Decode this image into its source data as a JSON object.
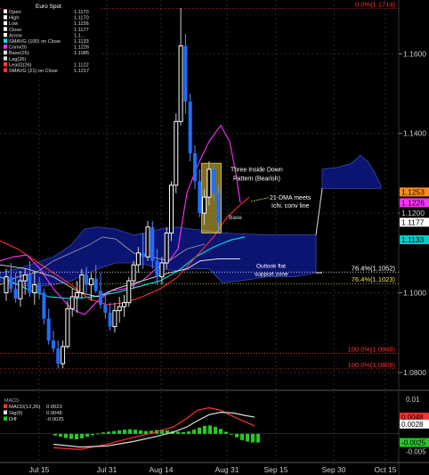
{
  "chart_data": {
    "type": "candlestick",
    "main_legend": {
      "title": "Euro Spot",
      "items": [
        {
          "name": "Open",
          "value": "1.1170",
          "color": "#ffffff"
        },
        {
          "name": "High",
          "value": "1.1170",
          "color": "#ffffff"
        },
        {
          "name": "Low",
          "value": "1.1156",
          "color": "#ffffff"
        },
        {
          "name": "Close",
          "value": "1.1177",
          "color": "#ffffff"
        },
        {
          "name": "Arrow",
          "value": "1.1...",
          "color": "#ffffff"
        },
        {
          "name": "SMAVG (100) on Close",
          "value": "1.1133",
          "color": "#00e5e5"
        },
        {
          "name": "Conv(9)",
          "value": "1.1226",
          "color": "#ff33ff"
        },
        {
          "name": "Base(26)",
          "value": "1.1085",
          "color": "#dddddd"
        },
        {
          "name": "Lag(26)",
          "value": "",
          "color": "#dddddd"
        },
        {
          "name": "Lead2(26)",
          "value": "1.1122",
          "color": "#ff4444"
        },
        {
          "name": "SMAVG (21) on Close",
          "value": "1.1217",
          "color": "#ff3030"
        }
      ]
    },
    "x_ticks": [
      "Jul 15",
      "Jul 31",
      "Aug 14",
      "Aug 31",
      "Sep 15",
      "Sep 30",
      "Oct 15"
    ],
    "y_ticks": [
      1.08,
      1.1,
      1.12,
      1.14,
      1.16
    ],
    "y_tick_labels": [
      "1.0800",
      "1.1000",
      "1.1200",
      "1.1400",
      "1.1600"
    ],
    "ylim": [
      1.0755,
      1.1735
    ],
    "fib_levels": [
      {
        "label": "0.0%(1.1714)",
        "value": 1.1714,
        "color": "#ff3030"
      },
      {
        "label": "76.4%(1.1052)",
        "value": 1.1052,
        "color": "#ffffff"
      },
      {
        "label": "76.4%(1.1023)",
        "value": 1.1023,
        "color": "#e8e840"
      },
      {
        "label": "100.0%(1.0848)",
        "value": 1.0848,
        "color": "#ff3030"
      },
      {
        "label": "100.0%(1.0809)",
        "value": 1.0809,
        "color": "#ff3030"
      }
    ],
    "annotations": {
      "pattern": [
        "Three Inside Down",
        "Pattern (Bearish)"
      ],
      "dma": [
        "21-DMA meets",
        "Ichi. conv line"
      ],
      "base": "Base",
      "cloud": [
        "Outlook flat",
        "support zone"
      ]
    },
    "price_tags": [
      {
        "value": 1.1253,
        "label": "1.1253",
        "bg": "#ff8c1a",
        "fg": "#000000"
      },
      {
        "value": 1.1226,
        "label": "1.1226",
        "bg": "#ff33ff",
        "fg": "#000000"
      },
      {
        "value": 1.12,
        "label": "1.1200",
        "bg": "#000000",
        "fg": "#cccccc"
      },
      {
        "value": 1.1177,
        "label": "1.1177",
        "bg": "#ffffff",
        "fg": "#000000"
      },
      {
        "value": 1.1133,
        "label": "1.1133",
        "bg": "#00cccc",
        "fg": "#000000"
      }
    ],
    "candles": [
      {
        "o": 1.1,
        "h": 1.106,
        "l": 1.098,
        "c": 1.104
      },
      {
        "o": 1.104,
        "h": 1.1075,
        "l": 1.1,
        "c": 1.101
      },
      {
        "o": 1.101,
        "h": 1.105,
        "l": 1.0975,
        "c": 1.0985
      },
      {
        "o": 1.0985,
        "h": 1.1055,
        "l": 1.0965,
        "c": 1.103
      },
      {
        "o": 1.103,
        "h": 1.106,
        "l": 1.0995,
        "c": 1.1045
      },
      {
        "o": 1.1045,
        "h": 1.108,
        "l": 1.099,
        "c": 1.1
      },
      {
        "o": 1.1,
        "h": 1.1055,
        "l": 1.097,
        "c": 1.102
      },
      {
        "o": 1.102,
        "h": 1.104,
        "l": 1.0985,
        "c": 1.1
      },
      {
        "o": 1.1,
        "h": 1.101,
        "l": 1.092,
        "c": 1.0935
      },
      {
        "o": 1.0935,
        "h": 1.096,
        "l": 1.087,
        "c": 1.088
      },
      {
        "o": 1.088,
        "h": 1.0905,
        "l": 1.085,
        "c": 1.086
      },
      {
        "o": 1.086,
        "h": 1.088,
        "l": 1.081,
        "c": 1.0822
      },
      {
        "o": 1.0822,
        "h": 1.088,
        "l": 1.081,
        "c": 1.0865
      },
      {
        "o": 1.0865,
        "h": 1.098,
        "l": 1.086,
        "c": 1.096
      },
      {
        "o": 1.096,
        "h": 1.101,
        "l": 1.094,
        "c": 1.099
      },
      {
        "o": 1.099,
        "h": 1.103,
        "l": 1.095,
        "c": 1.1
      },
      {
        "o": 1.1,
        "h": 1.106,
        "l": 1.0985,
        "c": 1.1045
      },
      {
        "o": 1.1045,
        "h": 1.1065,
        "l": 1.1,
        "c": 1.102
      },
      {
        "o": 1.102,
        "h": 1.105,
        "l": 1.098,
        "c": 1.1035
      },
      {
        "o": 1.1035,
        "h": 1.107,
        "l": 1.1,
        "c": 1.1005
      },
      {
        "o": 1.1005,
        "h": 1.105,
        "l": 1.096,
        "c": 1.097
      },
      {
        "o": 1.097,
        "h": 1.0995,
        "l": 1.0935,
        "c": 1.095
      },
      {
        "o": 1.095,
        "h": 1.0975,
        "l": 1.0905,
        "c": 1.0915
      },
      {
        "o": 1.0915,
        "h": 1.0975,
        "l": 1.09,
        "c": 1.0955
      },
      {
        "o": 1.0955,
        "h": 1.099,
        "l": 1.0925,
        "c": 1.0965
      },
      {
        "o": 1.0965,
        "h": 1.0995,
        "l": 1.094,
        "c": 1.0975
      },
      {
        "o": 1.0975,
        "h": 1.104,
        "l": 1.0965,
        "c": 1.103
      },
      {
        "o": 1.103,
        "h": 1.108,
        "l": 1.101,
        "c": 1.107
      },
      {
        "o": 1.107,
        "h": 1.1115,
        "l": 1.105,
        "c": 1.11
      },
      {
        "o": 1.11,
        "h": 1.115,
        "l": 1.106,
        "c": 1.109
      },
      {
        "o": 1.109,
        "h": 1.118,
        "l": 1.108,
        "c": 1.1165
      },
      {
        "o": 1.1165,
        "h": 1.118,
        "l": 1.106,
        "c": 1.108
      },
      {
        "o": 1.108,
        "h": 1.111,
        "l": 1.102,
        "c": 1.104
      },
      {
        "o": 1.104,
        "h": 1.109,
        "l": 1.102,
        "c": 1.1075
      },
      {
        "o": 1.1075,
        "h": 1.1165,
        "l": 1.106,
        "c": 1.115
      },
      {
        "o": 1.115,
        "h": 1.128,
        "l": 1.113,
        "c": 1.127
      },
      {
        "o": 1.127,
        "h": 1.145,
        "l": 1.125,
        "c": 1.143
      },
      {
        "o": 1.143,
        "h": 1.1715,
        "l": 1.142,
        "c": 1.162
      },
      {
        "o": 1.162,
        "h": 1.165,
        "l": 1.145,
        "c": 1.148
      },
      {
        "o": 1.148,
        "h": 1.15,
        "l": 1.133,
        "c": 1.135
      },
      {
        "o": 1.135,
        "h": 1.137,
        "l": 1.126,
        "c": 1.128
      },
      {
        "o": 1.128,
        "h": 1.131,
        "l": 1.119,
        "c": 1.12
      },
      {
        "o": 1.12,
        "h": 1.126,
        "l": 1.117,
        "c": 1.124
      },
      {
        "o": 1.124,
        "h": 1.133,
        "l": 1.122,
        "c": 1.131
      },
      {
        "o": 1.131,
        "h": 1.132,
        "l": 1.123,
        "c": 1.125
      },
      {
        "o": 1.125,
        "h": 1.127,
        "l": 1.115,
        "c": 1.1177
      }
    ],
    "candle_up_color": "#ffffff",
    "candle_down_color": "#1e6fff",
    "sub_panel": {
      "title": "MACD",
      "legend": [
        {
          "name": "MACD(12,26)",
          "value": "0.0023",
          "color": "#ff3030"
        },
        {
          "name": "Sig(9)",
          "value": "0.0048",
          "color": "#dddddd"
        },
        {
          "name": "Diff",
          "value": "-0.0025",
          "color": "#22cc22"
        }
      ],
      "y_ticks": [
        0.01,
        0.005,
        -0.005
      ],
      "y_tick_labels": [
        "0.01",
        "0.005",
        "-0.005"
      ],
      "ylim": [
        -0.008,
        0.012
      ],
      "tags": [
        {
          "value": 0.0048,
          "label": "0.0048",
          "bg": "#ff3030",
          "fg": "#000000"
        },
        {
          "value": 0.0028,
          "label": "0.0028",
          "bg": "#ffffff",
          "fg": "#000000"
        },
        {
          "value": -0.0025,
          "label": "-0.0025",
          "bg": "#22cc22",
          "fg": "#000000"
        }
      ]
    }
  }
}
